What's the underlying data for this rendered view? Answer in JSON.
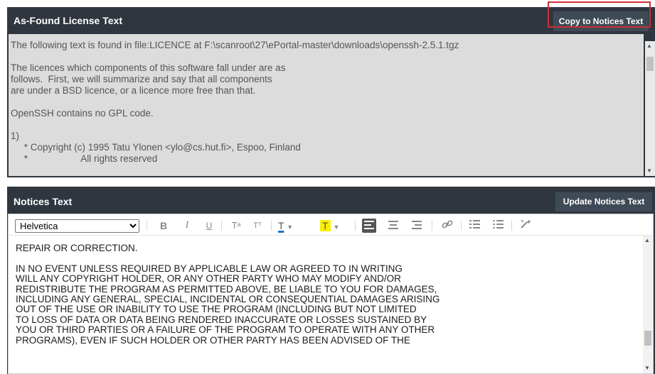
{
  "found_panel": {
    "title": "As-Found License Text",
    "copy_button": "Copy to Notices Text",
    "lines": "The following text is found in file:LICENCE at F:\\scanroot\\27\\ePortal-master\\downloads\\openssh-2.5.1.tgz\n\nThe licences which components of this software fall under are as\nfollows.  First, we will summarize and say that all components\nare under a BSD licence, or a licence more free than that.\n\nOpenSSH contains no GPL code.\n\n1)\n     * Copyright (c) 1995 Tatu Ylonen <ylo@cs.hut.fi>, Espoo, Finland\n     *                    All rights reserved"
  },
  "notices_panel": {
    "title": "Notices Text",
    "update_button": "Update Notices Text",
    "font_value": "Helvetica",
    "toolbar": {
      "bold": "B",
      "italic": "I",
      "underline": "U",
      "superscript": "Tᵃ",
      "subscript": "Tᵀ",
      "font_color": "T",
      "highlight_color": "T",
      "highlight_hex": "#f7f000",
      "font_color_hex": "#1e73be"
    },
    "content": "REPAIR OR CORRECTION.\n\nIN NO EVENT UNLESS REQUIRED BY APPLICABLE LAW OR AGREED TO IN WRITING\nWILL ANY COPYRIGHT HOLDER, OR ANY OTHER PARTY WHO MAY MODIFY AND/OR\nREDISTRIBUTE THE PROGRAM AS PERMITTED ABOVE, BE LIABLE TO YOU FOR DAMAGES,\nINCLUDING ANY GENERAL, SPECIAL, INCIDENTAL OR CONSEQUENTIAL DAMAGES ARISING\nOUT OF THE USE OR INABILITY TO USE THE PROGRAM (INCLUDING BUT NOT LIMITED\nTO LOSS OF DATA OR DATA BEING RENDERED INACCURATE OR LOSSES SUSTAINED BY\nYOU OR THIRD PARTIES OR A FAILURE OF THE PROGRAM TO OPERATE WITH ANY OTHER\nPROGRAMS), EVEN IF SUCH HOLDER OR OTHER PARTY HAS BEEN ADVISED OF THE"
  }
}
